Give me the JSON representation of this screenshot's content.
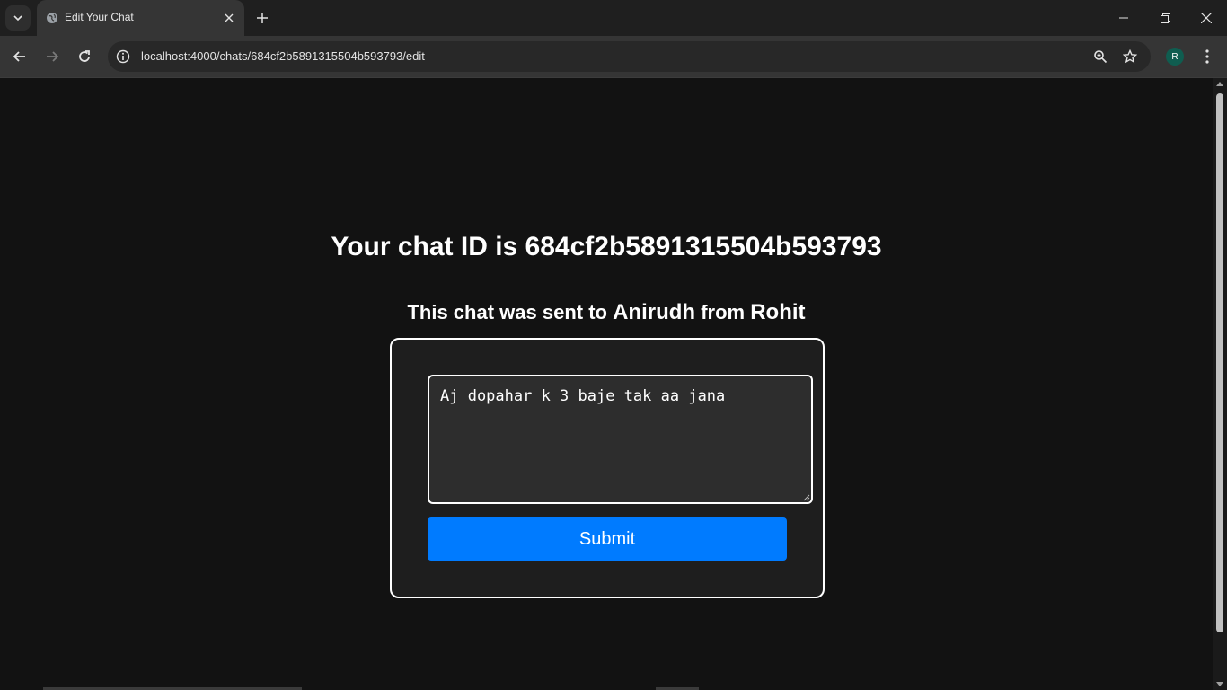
{
  "browser": {
    "tab_title": "Edit Your Chat",
    "url": "localhost:4000/chats/684cf2b5891315504b593793/edit",
    "profile_initial": "R"
  },
  "page": {
    "title": "Your chat ID is 684cf2b5891315504b593793",
    "subtitle_prefix": "This chat was sent to",
    "recipient": "Anirudh",
    "subtitle_middle": "from",
    "sender": "Rohit",
    "message_value": "Aj dopahar k 3 baje tak aa jana",
    "submit_label": "Submit"
  },
  "colors": {
    "page_bg": "#121212",
    "card_bg": "#1e1e1e",
    "button_bg": "#007bff",
    "text": "#ffffff"
  }
}
